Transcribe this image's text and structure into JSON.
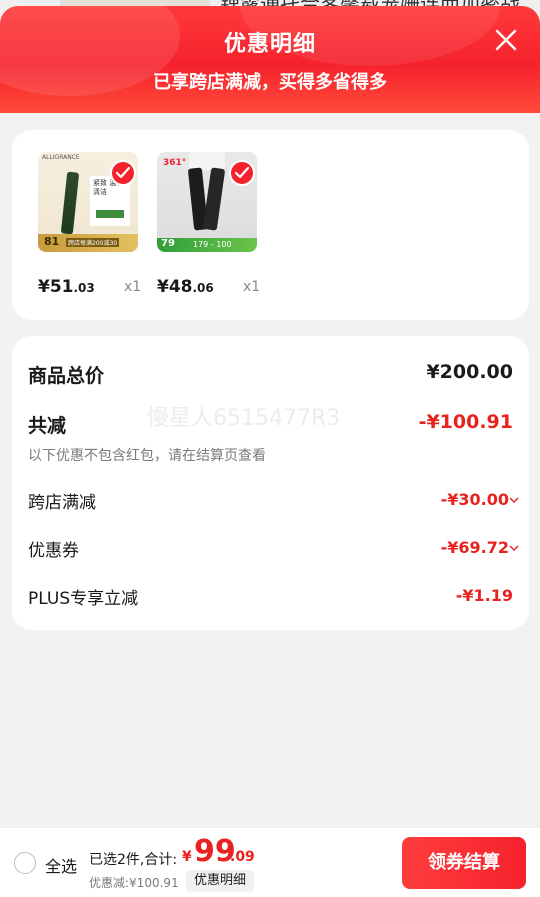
{
  "background": {
    "peek_text": "锂露通托合客馨载宠姗连而加密战"
  },
  "header": {
    "title": "优惠明细",
    "subtitle": "已享跨店满减，买得多省得多"
  },
  "products": [
    {
      "thumb_brand": "ALLIGRANCE",
      "thumb_text": "紧致 温和清洁",
      "thumb_price": "81",
      "thumb_note": "跨店每满200减30",
      "price_int": "¥51",
      "price_dec": ".03",
      "qty": "x1"
    },
    {
      "thumb_brand": "361°",
      "thumb_price": "79",
      "thumb_nums": "179 - 100",
      "price_int": "¥48",
      "price_dec": ".06",
      "qty": "x1"
    }
  ],
  "summary": {
    "total_label": "商品总价",
    "total_value": "¥200.00",
    "reduce_label": "共减",
    "reduce_value": "-¥100.91",
    "reduce_note": "以下优惠不包含红包，请在结算页查看",
    "watermark": "慢星人6515477R3",
    "items": [
      {
        "label": "跨店满减",
        "value": "-¥30.00"
      },
      {
        "label": "优惠券",
        "value": "-¥69.72"
      },
      {
        "label": "PLUS专享立减",
        "value": "-¥1.19"
      }
    ]
  },
  "bottom": {
    "select_all": "全选",
    "selected_text": "已选2件,合计:",
    "currency": "¥",
    "total_int": "99",
    "total_dec": ".09",
    "discount_text": "优惠减:¥100.91",
    "detail_button": "优惠明细",
    "checkout_button": "领券结算"
  },
  "colors": {
    "accent": "#f5222d",
    "price_red": "#e8231f"
  }
}
